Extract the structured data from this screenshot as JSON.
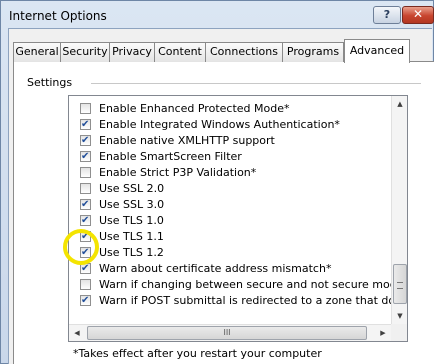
{
  "window": {
    "title": "Internet Options",
    "help_symbol": "?",
    "close_symbol": "✕"
  },
  "tabs": [
    "General",
    "Security",
    "Privacy",
    "Content",
    "Connections",
    "Programs",
    "Advanced"
  ],
  "active_tab": "Advanced",
  "settings": {
    "group_label": "Settings",
    "items": [
      {
        "label": "Enable Enhanced Protected Mode*",
        "checked": false
      },
      {
        "label": "Enable Integrated Windows Authentication*",
        "checked": true
      },
      {
        "label": "Enable native XMLHTTP support",
        "checked": true
      },
      {
        "label": "Enable SmartScreen Filter",
        "checked": true
      },
      {
        "label": "Enable Strict P3P Validation*",
        "checked": false
      },
      {
        "label": "Use SSL 2.0",
        "checked": false
      },
      {
        "label": "Use SSL 3.0",
        "checked": true
      },
      {
        "label": "Use TLS 1.0",
        "checked": true
      },
      {
        "label": "Use TLS 1.1",
        "checked": true
      },
      {
        "label": "Use TLS 1.2",
        "checked": true
      },
      {
        "label": "Warn about certificate address mismatch*",
        "checked": true
      },
      {
        "label": "Warn if changing between secure and not secure mode",
        "checked": false
      },
      {
        "label": "Warn if POST submittal is redirected to a zone that does n",
        "checked": true
      }
    ],
    "scroll_up": "▲",
    "scroll_down": "▼",
    "scroll_left": "◀",
    "scroll_right": "▶",
    "h_thumb_grip": "III"
  },
  "footnote": "*Takes effect after you restart your computer"
}
